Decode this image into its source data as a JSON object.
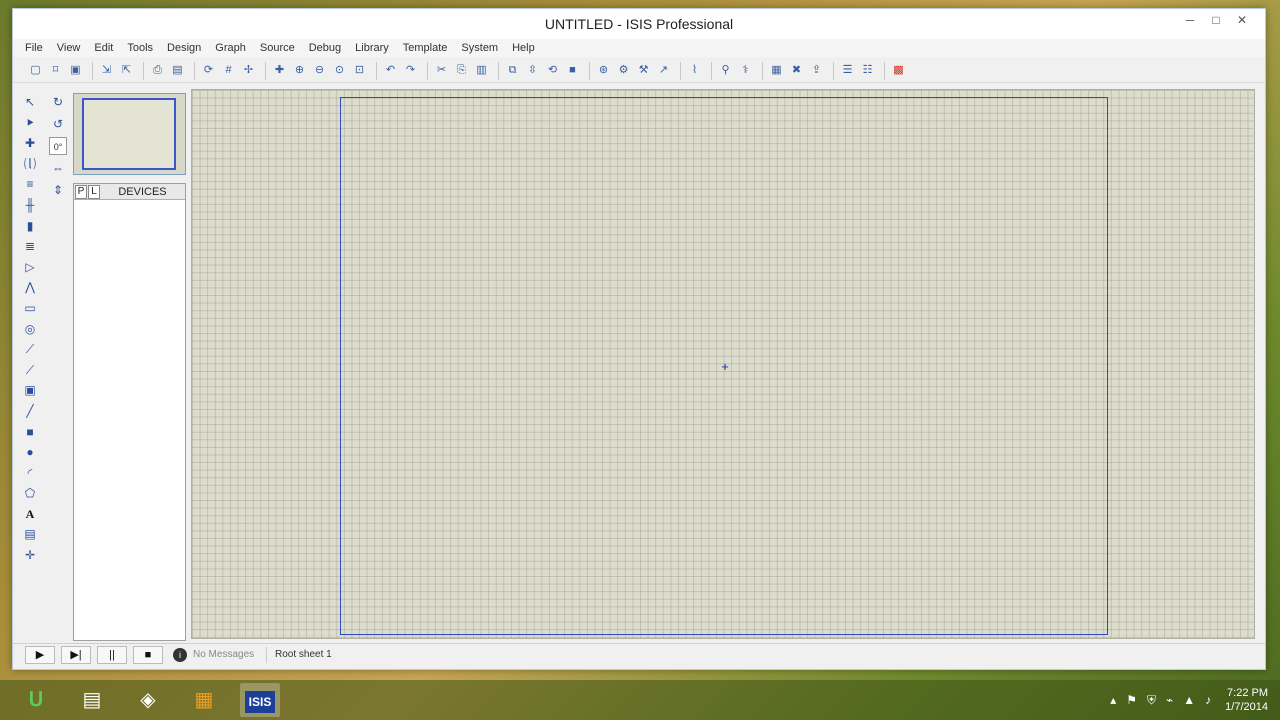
{
  "window": {
    "title": "UNTITLED - ISIS Professional",
    "controls": {
      "minimize": "─",
      "maximize": "□",
      "close": "✕"
    }
  },
  "menu": [
    "File",
    "View",
    "Edit",
    "Tools",
    "Design",
    "Graph",
    "Source",
    "Debug",
    "Library",
    "Template",
    "System",
    "Help"
  ],
  "toolbar_icons": [
    "new-icon",
    "open-icon",
    "save-icon",
    "sep",
    "import-icon",
    "export-icon",
    "sep",
    "print-icon",
    "print-area-icon",
    "sep",
    "refresh-icon",
    "grid-icon",
    "origin-icon",
    "sep",
    "pan-icon",
    "zoom-in-icon",
    "zoom-out-icon",
    "zoom-all-icon",
    "zoom-area-icon",
    "sep",
    "undo-icon",
    "redo-icon",
    "sep",
    "cut-icon",
    "copy-icon",
    "paste-icon",
    "sep",
    "block-copy-icon",
    "block-move-icon",
    "block-rotate-icon",
    "block-delete-icon",
    "sep",
    "pick-device-icon",
    "make-device-icon",
    "packaging-icon",
    "decompose-icon",
    "sep",
    "wire-autorouter-icon",
    "sep",
    "search-icon",
    "property-assign-icon",
    "sep",
    "new-sheet-icon",
    "remove-sheet-icon",
    "exit-sheet-icon",
    "sep",
    "bom-icon",
    "erc-icon",
    "sep",
    "netlist-ares-icon"
  ],
  "mode_icons": [
    "selection-mode-icon",
    "component-mode-icon",
    "junction-icon",
    "wire-label-icon",
    "text-script-icon",
    "bus-icon",
    "subcircuit-icon",
    "terminal-icon",
    "device-pin-icon",
    "graph-icon",
    "tape-recorder-icon",
    "generator-icon",
    "voltage-probe-icon",
    "current-probe-icon",
    "virtual-instrument-icon",
    "line-icon",
    "box-icon",
    "circle-icon",
    "arc-icon",
    "path-icon",
    "text-icon",
    "symbol-icon",
    "marker-icon"
  ],
  "rotation_icons": [
    "rotate-cw-icon",
    "rotate-ccw-icon",
    "angle-field",
    "mirror-x-icon",
    "mirror-y-icon"
  ],
  "angle_value": "0°",
  "devices_panel": {
    "p_label": "P",
    "l_label": "L",
    "title": "DEVICES"
  },
  "status": {
    "sim_buttons": [
      "▶",
      "▶|",
      "||",
      "■"
    ],
    "msg_icon": "i",
    "messages": "No Messages",
    "sheet": "Root sheet 1"
  },
  "taskbar": {
    "clock_time": "7:22 PM",
    "clock_date": "1/7/2014",
    "isis_label": "ISIS"
  }
}
